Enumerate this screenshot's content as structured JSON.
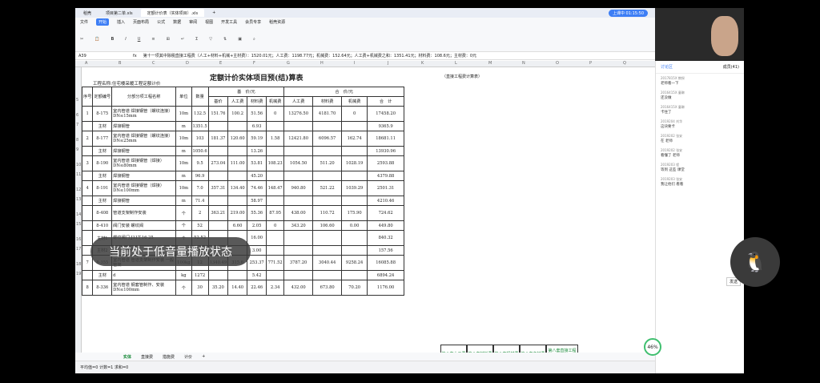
{
  "tabs": [
    {
      "label": "稻壳"
    },
    {
      "label": "项目第二单.xls"
    },
    {
      "label": "定额计价表（实体项目）.xls"
    }
  ],
  "menu": [
    "文件",
    "开始",
    "插入",
    "页面布局",
    "公式",
    "数据",
    "审阅",
    "视图",
    "开发工具",
    "会员专享",
    "稻壳资源"
  ],
  "menu_active": "开始",
  "upload": "上课中 01:15:50",
  "cell_ref": "A39",
  "formula": "第十一项其中除税直接工程费（人工+材料+机械+主材费）：1520.01元；人工费：1198.77元；机械费：152.64元；人工费+机械费之和：1351.41元；材料费：108.6元；主材费：0元",
  "title": "定额计价实体项目预(结)算表",
  "project": "工程名称:住宅楼采暖工程定额计价",
  "right_note": "（直接工程费计算表）",
  "col_letters": [
    "A",
    "B",
    "C",
    "D",
    "E",
    "F",
    "G",
    "H",
    "I",
    "J",
    "K",
    "L",
    "M",
    "N",
    "O",
    "P",
    "Q",
    "R",
    "S"
  ],
  "header1": [
    "序号",
    "定额编号",
    "分部分项工程名称",
    "单位",
    "数量",
    "基　价/元",
    "合　价/元"
  ],
  "header2": [
    "基价",
    "人工费",
    "材料费",
    "机械费",
    "人工费",
    "材料费",
    "机械费",
    "合　计"
  ],
  "rows": [
    {
      "r": "5",
      "c": [
        "1",
        "8-175",
        "室内管道 焊接钢管（螺纹连接）DN≤15mm",
        "10m",
        "132.5",
        "151.76",
        "100.2",
        "51.56",
        "0",
        "13276.50",
        "4181.70",
        "0",
        "17458.20"
      ]
    },
    {
      "r": "6",
      "c": [
        "",
        "主材",
        "焊接钢管",
        "m",
        "1351.5",
        "",
        "",
        "6.93",
        "",
        "",
        "",
        "",
        "9365.9"
      ]
    },
    {
      "r": "7",
      "c": [
        "2",
        "8-177",
        "室内管道 焊接钢管（螺纹连接）DN≤25mm",
        "10m",
        "103",
        "181.37",
        "120.60",
        "59.19",
        "1.58",
        "12421.80",
        "6096.57",
        "162.74",
        "18681.11"
      ]
    },
    {
      "r": "8",
      "c": [
        "",
        "主材",
        "焊接钢管",
        "m",
        "1050.6",
        "",
        "",
        "13.26",
        "",
        "",
        "",
        "",
        "13930.96"
      ]
    },
    {
      "r": "9",
      "c": [
        "3",
        "8-190",
        "室内管道 焊接钢管（焊接）DN≤80mm",
        "10m",
        "9.5",
        "273.04",
        "111.00",
        "53.81",
        "108.23",
        "1054.50",
        "511.20",
        "1028.19",
        "2593.88"
      ]
    },
    {
      "r": "10",
      "c": [
        "",
        "主材",
        "焊接钢管",
        "m",
        "96.9",
        "",
        "",
        "45.20",
        "",
        "",
        "",
        "",
        "4379.88"
      ]
    },
    {
      "r": "11",
      "c": [
        "4",
        "8-191",
        "室内管道 焊接钢管（焊接）DN≤100mm",
        "10m",
        "7.0",
        "357.31",
        "134.40",
        "74.46",
        "148.47",
        "940.80",
        "521.22",
        "1039.29",
        "2501.31"
      ]
    },
    {
      "r": "12",
      "c": [
        "",
        "主材",
        "焊接钢管",
        "m",
        "71.4",
        "",
        "",
        "58.97",
        "",
        "",
        "",
        "",
        "4210.46"
      ]
    },
    {
      "r": "13",
      "c": [
        "",
        "8-408",
        "管道支架制作安装",
        "个",
        "2",
        "363.21",
        "219.00",
        "55.36",
        "87.95",
        "438.00",
        "110.72",
        "175.90",
        "724.62"
      ]
    },
    {
      "r": "14",
      "c": [
        "",
        "8-410",
        "阀门安装 螺纹阀",
        "个",
        "52",
        "",
        "6.60",
        "2.05",
        "0",
        "343.20",
        "106.60",
        "0.00",
        "449.80"
      ]
    },
    {
      "r": "15",
      "c": [
        "",
        "主材1",
        "螺纹阀门 J11T-16-25",
        "个",
        "52.52",
        "",
        "",
        "16.00",
        "",
        "",
        "",
        "",
        "840.32"
      ]
    },
    {
      "r": "16",
      "c": [
        "",
        "主材2",
        "阀门连接件",
        "个",
        "52.52",
        "",
        "",
        "3.00",
        "",
        "",
        "",
        "",
        "157.56"
      ]
    },
    {
      "r": "17",
      "c": [
        "7",
        "8-355",
        "室内管道 管道支架制作安装 一般管架",
        "100kg",
        "12",
        "1340.49",
        "315.6",
        "253.37",
        "771.52",
        "3787.20",
        "3040.44",
        "9258.24",
        "16085.88"
      ]
    },
    {
      "r": "18",
      "c": [
        "",
        "主材",
        "d",
        "kg",
        "1272",
        "",
        "",
        "5.42",
        "",
        "",
        "",
        "",
        "6894.24"
      ]
    },
    {
      "r": "19",
      "c": [
        "8",
        "8-336",
        "室内管道 钢套管制作、安装 DN≤100mm",
        "个",
        "30",
        "35.20",
        "14.40",
        "22.46",
        "2.34",
        "432.00",
        "673.80",
        "70.20",
        "1176.00"
      ]
    }
  ],
  "green_labels": [
    "第八套人工费",
    "第八套材料费",
    "第八套机械费",
    "第八套主材费",
    "第八套直接工程费"
  ],
  "overlay": "当前处于低音量播放状态",
  "sheet_tabs": [
    "实体",
    "直接费",
    "措施费",
    "计价"
  ],
  "sheet_active": "实体",
  "status": "平均值=0  计数=1  求和=0",
  "chat": {
    "title": "讨论区",
    "members": "成员(41)",
    "messages": [
      {
        "who": "2017815X 教授",
        "text": "老师看一下"
      },
      {
        "who": "2016415X 童琳",
        "text": "还没做"
      },
      {
        "who": "2016415X 童琳",
        "text": "卡住了"
      },
      {
        "who": "2019204 刘华",
        "text": "这块要卡"
      },
      {
        "who": "2019202 张安",
        "text": "在 老师"
      },
      {
        "who": "2019202 张安",
        "text": "看懂了 老师"
      },
      {
        "who": "2019203 程",
        "text": "等到 这些 课堂"
      },
      {
        "who": "2019203 张安",
        "text": "我让他们 看看"
      }
    ]
  },
  "send_label": "发送",
  "badge": "46%"
}
